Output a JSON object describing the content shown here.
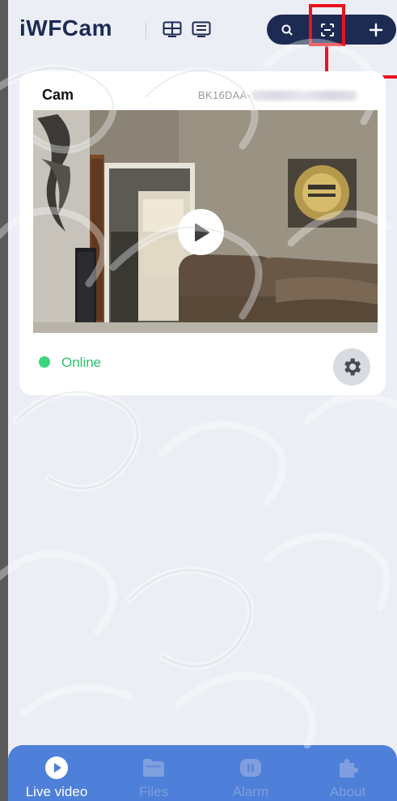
{
  "header": {
    "logo": "iWFCam",
    "icons": [
      "grid-view-icon",
      "list-view-icon",
      "search-icon",
      "scan-icon",
      "add-icon"
    ]
  },
  "camera": {
    "name": "Cam",
    "device_id": "BK16DAA-",
    "status": "Online",
    "status_color": "#2cc36b"
  },
  "nav": {
    "items": [
      {
        "label": "Live video",
        "icon": "play-icon",
        "active": true
      },
      {
        "label": "Files",
        "icon": "folder-icon",
        "active": false
      },
      {
        "label": "Alarm",
        "icon": "alarm-icon",
        "active": false
      },
      {
        "label": "About",
        "icon": "puzzle-icon",
        "active": false
      }
    ]
  },
  "colors": {
    "brand_dark": "#1d2a52",
    "nav_blue": "#4e7fd9",
    "highlight": "#e8141f",
    "online": "#3cd47c"
  }
}
